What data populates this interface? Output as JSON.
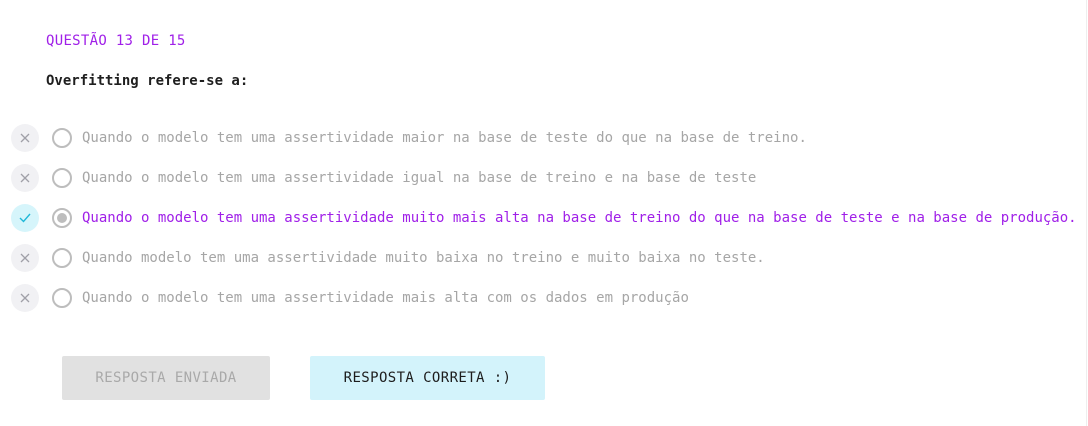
{
  "quiz": {
    "counter": "QUESTÃO 13 DE 15",
    "question": "Overfitting refere-se a:",
    "options": [
      {
        "label": "Quando o modelo tem uma assertividade maior na base de teste do que na base de treino.",
        "status_icon": "x-icon",
        "selected": false
      },
      {
        "label": "Quando o modelo tem uma assertividade igual na base de treino e na base de teste",
        "status_icon": "x-icon",
        "selected": false
      },
      {
        "label": "Quando o modelo tem uma assertividade muito mais alta na base de treino do que na base de teste e na base de produção.",
        "status_icon": "check-icon",
        "selected": true
      },
      {
        "label": "Quando modelo tem uma assertividade muito baixa no treino e muito baixa no teste.",
        "status_icon": "x-icon",
        "selected": false
      },
      {
        "label": "Quando o modelo tem uma assertividade mais alta com os dados em produção",
        "status_icon": "x-icon",
        "selected": false
      }
    ]
  },
  "buttons": {
    "sent_label": "RESPOSTA ENVIADA",
    "result_label": "RESPOSTA CORRETA :)"
  },
  "colors": {
    "accent": "#a020e8",
    "correct_bg": "#d3f3fb",
    "check": "#20b8d8",
    "muted_text": "#a6a6a6"
  }
}
